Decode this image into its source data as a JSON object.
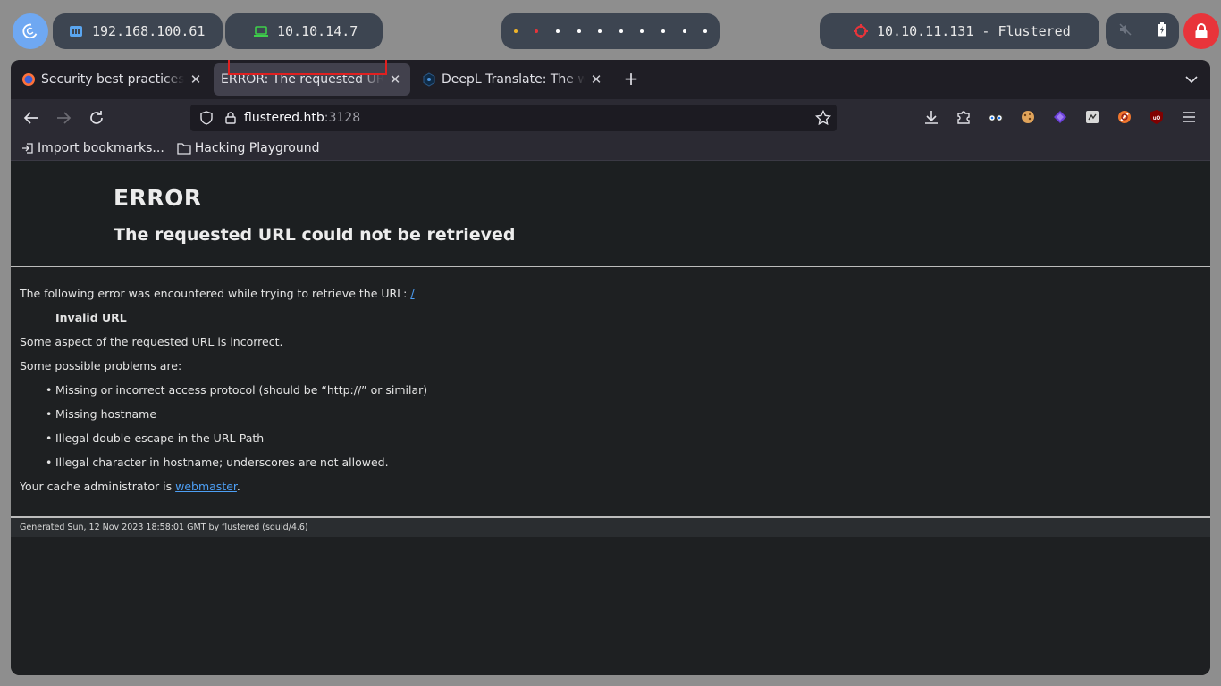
{
  "desktop": {
    "pills": [
      {
        "name": "host-ip",
        "text": "192.168.100.61",
        "color": "#5aa6f0"
      },
      {
        "name": "vpn-ip",
        "text": "10.10.14.7",
        "color": "#3ecf4a"
      },
      {
        "name": "target",
        "text": "10.10.11.131 - Flustered",
        "color": "#e8343a"
      }
    ],
    "workspace_dot_colors": [
      "#f0b429",
      "#e8343a",
      "#ffffff",
      "#ffffff",
      "#ffffff",
      "#ffffff",
      "#ffffff",
      "#ffffff",
      "#ffffff",
      "#ffffff"
    ]
  },
  "browser": {
    "tabs": [
      {
        "label": "Security best practices | ",
        "active": false
      },
      {
        "label": "ERROR: The requested URL c",
        "active": true
      },
      {
        "label": "DeepL Translate: The wo",
        "active": false
      }
    ],
    "url": {
      "host": "flustered.htb",
      "port": ":3128"
    },
    "bookmarks": [
      {
        "label": "Import bookmarks...",
        "icon": "import-icon"
      },
      {
        "label": "Hacking Playground",
        "icon": "folder-icon"
      }
    ]
  },
  "page": {
    "title": "ERROR",
    "subtitle": "The requested URL could not be retrieved",
    "intro": "The following error was encountered while trying to retrieve the URL: ",
    "intro_link": "/",
    "error_name": "Invalid URL",
    "description": "Some aspect of the requested URL is incorrect.",
    "problems_heading": "Some possible problems are:",
    "problems": [
      "Missing or incorrect access protocol (should be “http://” or similar)",
      "Missing hostname",
      "Illegal double-escape in the URL-Path",
      "Illegal character in hostname; underscores are not allowed."
    ],
    "admin_prefix": "Your cache administrator is ",
    "admin_link": "webmaster",
    "admin_suffix": ".",
    "footer": "Generated Sun, 12 Nov 2023 18:58:01 GMT by flustered (squid/4.6)"
  }
}
